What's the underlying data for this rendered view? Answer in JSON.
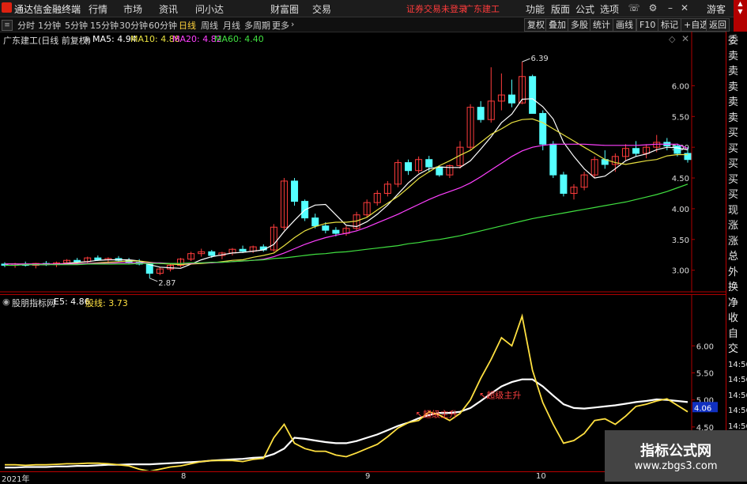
{
  "app": {
    "title": "通达信金融终端",
    "menu": [
      "行情",
      "市场",
      "资讯",
      "问小达",
      "财富圈",
      "交易"
    ],
    "login_warning": "证券交易未登录",
    "stock_name": "广东建工",
    "right_menu": [
      "功能",
      "版面",
      "公式",
      "选项"
    ],
    "guest": "游客"
  },
  "toolbar": {
    "periods": [
      "分时",
      "1分钟",
      "5分钟",
      "15分钟",
      "30分钟",
      "60分钟",
      "日线",
      "周线",
      "月线",
      "多周期",
      "更多"
    ],
    "active_period": "日线",
    "right_buttons": [
      "复权",
      "叠加",
      "多股",
      "统计",
      "画线",
      "F10",
      "标记",
      "+自选",
      "返回"
    ]
  },
  "main_info": {
    "title": "广东建工(日线 前复权)",
    "ma5": "MA5: 4.94",
    "ma10": "MA10: 4.88",
    "ma20": "MA20: 4.82",
    "ma60": "MA60: 4.40",
    "colors": {
      "ma5": "#ffffff",
      "ma10": "#e8e040",
      "ma20": "#ff40ff",
      "ma60": "#40e040"
    }
  },
  "sub_info": {
    "title": "股朋指标网",
    "e5": "E5: 4.86",
    "line": "股线: 3.73"
  },
  "annotations": {
    "high": "6.39",
    "low": "2.87",
    "tag1": "超级主升",
    "tag2": "超级主升",
    "current": "4.06"
  },
  "side_panel": [
    "委比",
    "卖五",
    "卖四",
    "卖三",
    "卖二",
    "卖一",
    "买一",
    "买二",
    "买三",
    "买四",
    "买五",
    "现价",
    "涨跌",
    "涨幅",
    "总量",
    "外盘",
    "换手",
    "净资",
    "收益",
    "自动",
    "交易",
    "14:56",
    "14:56",
    "14:56",
    "14:56",
    "14:56",
    "14:56"
  ],
  "xaxis": [
    "2021年",
    "8",
    "9",
    "10"
  ],
  "watermark": {
    "title": "指标公式网",
    "url": "www.zbgs3.com"
  },
  "chart_data": [
    {
      "type": "candlestick",
      "title": "广东建工(日线 前复权)",
      "ylim": [
        2.7,
        6.7
      ],
      "yticks": [
        3.0,
        3.5,
        4.0,
        4.5,
        5.0,
        5.5,
        6.0
      ],
      "colors": {
        "up": "#ff3c3c",
        "down": "#54ffff"
      },
      "candles": [
        [
          3.1,
          3.13,
          3.05,
          3.08
        ],
        [
          3.08,
          3.12,
          3.04,
          3.1
        ],
        [
          3.1,
          3.14,
          3.06,
          3.08
        ],
        [
          3.08,
          3.12,
          3.03,
          3.11
        ],
        [
          3.11,
          3.15,
          3.07,
          3.09
        ],
        [
          3.09,
          3.14,
          3.05,
          3.12
        ],
        [
          3.12,
          3.18,
          3.09,
          3.16
        ],
        [
          3.16,
          3.2,
          3.12,
          3.14
        ],
        [
          3.14,
          3.22,
          3.11,
          3.2
        ],
        [
          3.2,
          3.24,
          3.15,
          3.17
        ],
        [
          3.17,
          3.21,
          3.12,
          3.19
        ],
        [
          3.19,
          3.23,
          3.14,
          3.16
        ],
        [
          3.16,
          3.2,
          3.1,
          3.13
        ],
        [
          3.13,
          3.18,
          3.08,
          3.1
        ],
        [
          3.1,
          3.12,
          2.87,
          2.95
        ],
        [
          2.95,
          3.05,
          2.92,
          3.02
        ],
        [
          3.02,
          3.1,
          2.98,
          3.08
        ],
        [
          3.08,
          3.2,
          3.05,
          3.18
        ],
        [
          3.18,
          3.3,
          3.15,
          3.27
        ],
        [
          3.27,
          3.35,
          3.22,
          3.3
        ],
        [
          3.3,
          3.33,
          3.2,
          3.24
        ],
        [
          3.24,
          3.3,
          3.18,
          3.28
        ],
        [
          3.28,
          3.36,
          3.24,
          3.34
        ],
        [
          3.34,
          3.4,
          3.28,
          3.31
        ],
        [
          3.31,
          3.4,
          3.28,
          3.38
        ],
        [
          3.38,
          3.42,
          3.3,
          3.33
        ],
        [
          3.33,
          3.75,
          3.3,
          3.7
        ],
        [
          3.7,
          4.5,
          3.65,
          4.45
        ],
        [
          4.45,
          4.5,
          4.05,
          4.12
        ],
        [
          4.12,
          4.15,
          3.8,
          3.85
        ],
        [
          3.85,
          3.92,
          3.68,
          3.72
        ],
        [
          3.72,
          3.78,
          3.6,
          3.65
        ],
        [
          3.65,
          3.7,
          3.55,
          3.6
        ],
        [
          3.6,
          3.72,
          3.56,
          3.68
        ],
        [
          3.68,
          3.95,
          3.65,
          3.9
        ],
        [
          3.9,
          4.15,
          3.85,
          4.1
        ],
        [
          4.1,
          4.3,
          4.05,
          4.25
        ],
        [
          4.25,
          4.45,
          4.2,
          4.4
        ],
        [
          4.4,
          4.8,
          4.35,
          4.75
        ],
        [
          4.75,
          4.8,
          4.55,
          4.62
        ],
        [
          4.62,
          4.85,
          4.58,
          4.8
        ],
        [
          4.8,
          4.86,
          4.6,
          4.68
        ],
        [
          4.68,
          4.7,
          4.52,
          4.55
        ],
        [
          4.55,
          4.72,
          4.5,
          4.7
        ],
        [
          4.7,
          5.1,
          4.65,
          5.0
        ],
        [
          5.0,
          5.7,
          4.95,
          5.65
        ],
        [
          5.65,
          5.75,
          5.4,
          5.45
        ],
        [
          5.45,
          6.3,
          5.4,
          5.75
        ],
        [
          5.75,
          6.2,
          5.6,
          5.85
        ],
        [
          5.85,
          6.1,
          5.65,
          5.72
        ],
        [
          5.72,
          6.39,
          5.7,
          6.15
        ],
        [
          6.15,
          6.18,
          5.55,
          5.55
        ],
        [
          5.55,
          5.6,
          4.95,
          5.05
        ],
        [
          5.05,
          5.1,
          4.5,
          4.55
        ],
        [
          4.55,
          4.6,
          4.2,
          4.25
        ],
        [
          4.25,
          4.4,
          4.15,
          4.35
        ],
        [
          4.35,
          4.6,
          4.3,
          4.55
        ],
        [
          4.55,
          4.85,
          4.5,
          4.8
        ],
        [
          4.8,
          4.95,
          4.65,
          4.72
        ],
        [
          4.72,
          4.9,
          4.6,
          4.85
        ],
        [
          4.85,
          5.05,
          4.78,
          4.98
        ],
        [
          4.98,
          5.1,
          4.85,
          4.9
        ],
        [
          4.9,
          5.05,
          4.82,
          5.0
        ],
        [
          5.0,
          5.2,
          4.92,
          5.08
        ],
        [
          5.08,
          5.15,
          4.95,
          5.02
        ],
        [
          5.02,
          5.06,
          4.85,
          4.9
        ],
        [
          4.9,
          5.0,
          4.75,
          4.8
        ]
      ],
      "series": [
        {
          "name": "MA5",
          "values": [
            3.1,
            3.1,
            3.09,
            3.09,
            3.09,
            3.1,
            3.11,
            3.13,
            3.14,
            3.16,
            3.17,
            3.17,
            3.17,
            3.15,
            3.09,
            3.05,
            3.04,
            3.03,
            3.1,
            3.17,
            3.22,
            3.25,
            3.28,
            3.29,
            3.31,
            3.33,
            3.42,
            3.63,
            3.81,
            3.98,
            4.06,
            4.07,
            3.9,
            3.73,
            3.71,
            3.79,
            3.91,
            4.06,
            4.24,
            4.42,
            4.56,
            4.65,
            4.68,
            4.67,
            4.67,
            4.78,
            4.97,
            5.17,
            5.4,
            5.54,
            5.78,
            5.79,
            5.66,
            5.46,
            5.08,
            4.85,
            4.65,
            4.5,
            4.53,
            4.65,
            4.78,
            4.85,
            4.89,
            4.96,
            5.0,
            4.99,
            4.96
          ]
        },
        {
          "name": "MA10",
          "values": [
            3.1,
            3.1,
            3.1,
            3.1,
            3.1,
            3.1,
            3.1,
            3.11,
            3.11,
            3.12,
            3.13,
            3.14,
            3.15,
            3.15,
            3.13,
            3.11,
            3.1,
            3.09,
            3.1,
            3.11,
            3.12,
            3.14,
            3.16,
            3.17,
            3.21,
            3.24,
            3.28,
            3.4,
            3.53,
            3.64,
            3.71,
            3.76,
            3.78,
            3.78,
            3.8,
            3.86,
            3.98,
            4.09,
            4.2,
            4.34,
            4.49,
            4.6,
            4.7,
            4.78,
            4.87,
            4.95,
            5.08,
            5.21,
            5.3,
            5.4,
            5.45,
            5.46,
            5.4,
            5.3,
            5.2,
            5.1,
            5.0,
            4.9,
            4.8,
            4.75,
            4.72,
            4.75,
            4.78,
            4.8,
            4.86,
            4.88,
            4.88
          ]
        },
        {
          "name": "MA20",
          "values": [
            3.1,
            3.1,
            3.1,
            3.1,
            3.1,
            3.1,
            3.1,
            3.1,
            3.11,
            3.11,
            3.11,
            3.12,
            3.12,
            3.12,
            3.12,
            3.12,
            3.11,
            3.11,
            3.11,
            3.12,
            3.12,
            3.13,
            3.14,
            3.15,
            3.16,
            3.18,
            3.22,
            3.28,
            3.35,
            3.42,
            3.48,
            3.53,
            3.57,
            3.6,
            3.64,
            3.7,
            3.77,
            3.84,
            3.91,
            3.99,
            4.07,
            4.15,
            4.22,
            4.28,
            4.34,
            4.42,
            4.52,
            4.63,
            4.74,
            4.85,
            4.94,
            5.0,
            5.03,
            5.05,
            5.05,
            5.05,
            5.05,
            5.04,
            5.03,
            5.03,
            5.03,
            5.03,
            5.04,
            5.05,
            5.05,
            5.05,
            4.98
          ]
        },
        {
          "name": "MA60",
          "values": [
            3.08,
            3.08,
            3.09,
            3.09,
            3.09,
            3.09,
            3.09,
            3.09,
            3.1,
            3.1,
            3.1,
            3.1,
            3.1,
            3.11,
            3.11,
            3.11,
            3.11,
            3.11,
            3.12,
            3.12,
            3.13,
            3.13,
            3.14,
            3.15,
            3.16,
            3.17,
            3.19,
            3.2,
            3.22,
            3.24,
            3.26,
            3.27,
            3.29,
            3.3,
            3.32,
            3.34,
            3.36,
            3.38,
            3.4,
            3.43,
            3.45,
            3.48,
            3.5,
            3.53,
            3.56,
            3.6,
            3.64,
            3.68,
            3.72,
            3.76,
            3.8,
            3.84,
            3.87,
            3.9,
            3.93,
            3.96,
            3.99,
            4.02,
            4.05,
            4.08,
            4.11,
            4.15,
            4.19,
            4.23,
            4.28,
            4.34,
            4.4
          ]
        }
      ]
    },
    {
      "type": "line",
      "title": "股朋指标网",
      "ylim": [
        3.65,
        6.75
      ],
      "yticks": [
        4.0,
        4.5,
        5.0,
        5.5,
        6.0
      ],
      "series": [
        {
          "name": "E5",
          "color": "#ffffff",
          "values": [
            3.75,
            3.75,
            3.76,
            3.76,
            3.76,
            3.77,
            3.77,
            3.78,
            3.78,
            3.79,
            3.8,
            3.8,
            3.81,
            3.81,
            3.81,
            3.82,
            3.83,
            3.84,
            3.85,
            3.86,
            3.88,
            3.89,
            3.9,
            3.91,
            3.93,
            3.94,
            4.0,
            4.1,
            4.3,
            4.28,
            4.25,
            4.22,
            4.2,
            4.2,
            4.24,
            4.3,
            4.36,
            4.44,
            4.52,
            4.58,
            4.66,
            4.72,
            4.76,
            4.76,
            4.78,
            4.85,
            4.98,
            5.12,
            5.25,
            5.33,
            5.38,
            5.38,
            5.25,
            5.08,
            4.92,
            4.85,
            4.84,
            4.86,
            4.88,
            4.9,
            4.93,
            4.96,
            4.98,
            5.01,
            5.0,
            4.98,
            4.96
          ]
        },
        {
          "name": "股线",
          "color": "#ffe040",
          "values": [
            3.8,
            3.8,
            3.79,
            3.8,
            3.8,
            3.81,
            3.82,
            3.82,
            3.83,
            3.83,
            3.82,
            3.8,
            3.78,
            3.72,
            3.68,
            3.72,
            3.76,
            3.78,
            3.82,
            3.86,
            3.88,
            3.88,
            3.88,
            3.86,
            3.9,
            3.92,
            4.3,
            4.55,
            4.2,
            4.1,
            4.05,
            4.05,
            3.98,
            3.95,
            4.02,
            4.1,
            4.18,
            4.32,
            4.48,
            4.58,
            4.62,
            4.78,
            4.72,
            4.62,
            4.75,
            5.0,
            5.4,
            5.75,
            6.15,
            6.0,
            6.55,
            5.55,
            4.95,
            4.55,
            4.2,
            4.25,
            4.38,
            4.62,
            4.65,
            4.55,
            4.7,
            4.88,
            4.92,
            4.98,
            5.02,
            4.9,
            4.78
          ]
        }
      ]
    }
  ]
}
